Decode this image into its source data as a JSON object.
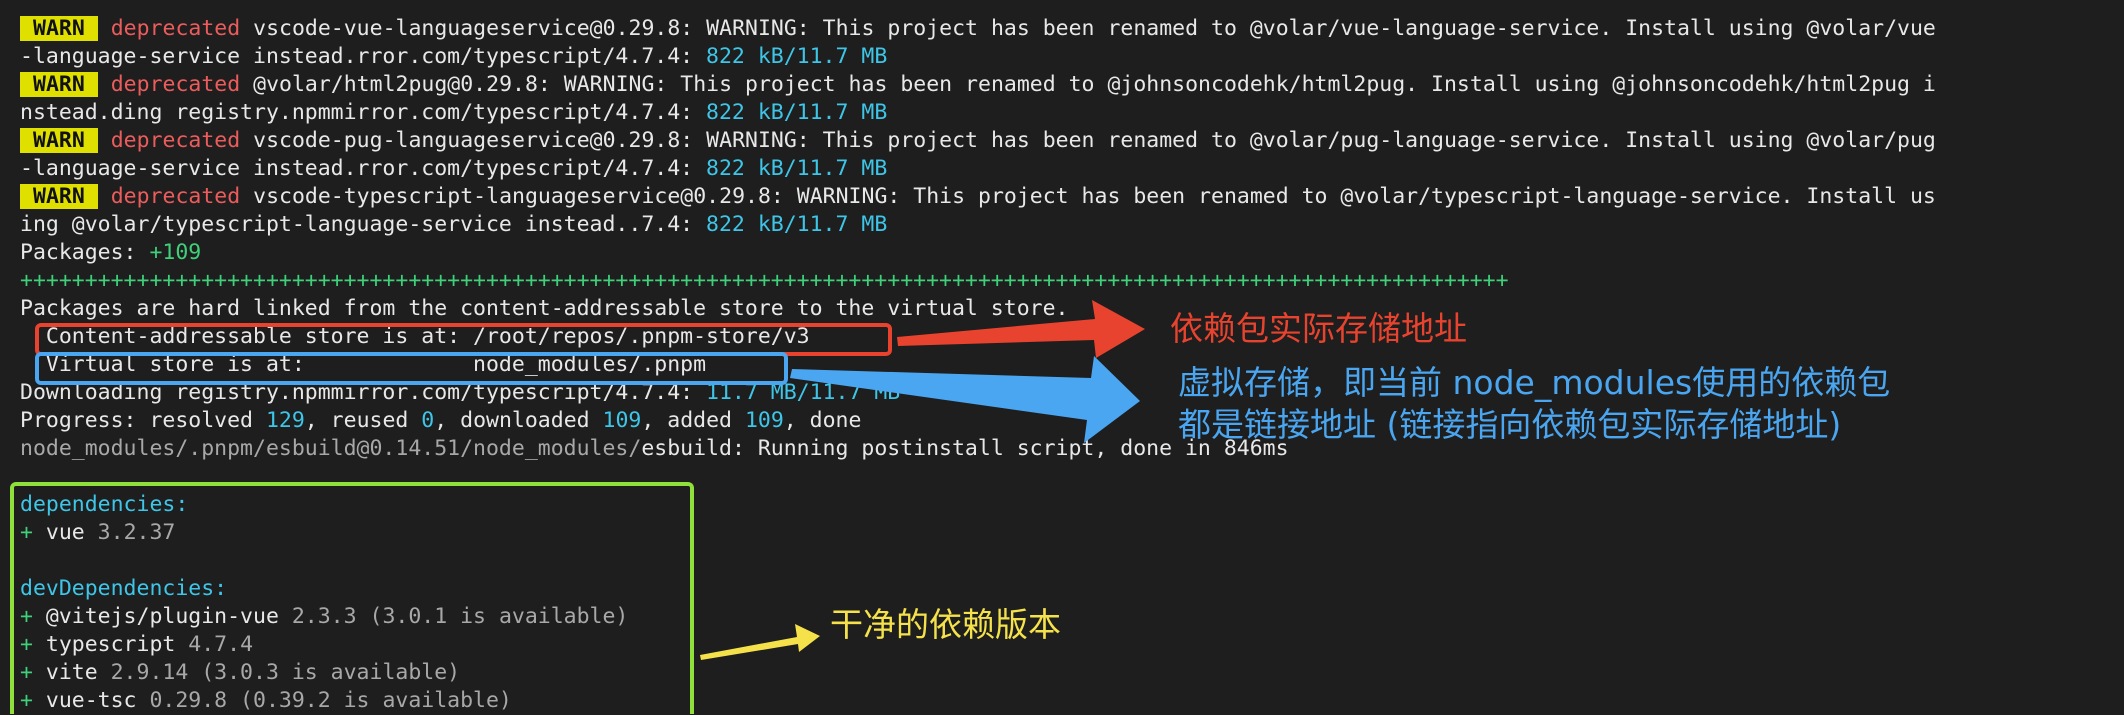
{
  "terminal": {
    "warn1": {
      "tag": "WARN",
      "level": "deprecated",
      "text": " vscode-vue-languageservice@0.29.8: WARNING: This project has been renamed to @volar/vue-language-service. Install using @volar/vue",
      "cont": "-language-service instead.rror.com/typescript/4.7.4: ",
      "progress_done": "822 kB",
      "sep": "/",
      "progress_total": "11.7 MB"
    },
    "warn2": {
      "tag": "WARN",
      "level": "deprecated",
      "text": " @volar/html2pug@0.29.8: WARNING: This project has been renamed to @johnsoncodehk/html2pug. Install using @johnsoncodehk/html2pug i",
      "cont": "nstead.ding registry.npmmirror.com/typescript/4.7.4: ",
      "progress_done": "822 kB",
      "sep": "/",
      "progress_total": "11.7 MB"
    },
    "warn3": {
      "tag": "WARN",
      "level": "deprecated",
      "text": " vscode-pug-languageservice@0.29.8: WARNING: This project has been renamed to @volar/pug-language-service. Install using @volar/pug",
      "cont": "-language-service instead.rror.com/typescript/4.7.4: ",
      "progress_done": "822 kB",
      "sep": "/",
      "progress_total": "11.7 MB"
    },
    "warn4": {
      "tag": "WARN",
      "level": "deprecated",
      "text": " vscode-typescript-languageservice@0.29.8: WARNING: This project has been renamed to @volar/typescript-language-service. Install us",
      "cont": "ing @volar/typescript-language-service instead..7.4: ",
      "progress_done": "822 kB",
      "sep": "/",
      "progress_total": "11.7 MB"
    },
    "packages": {
      "label": "Packages: ",
      "count": "+109"
    },
    "plus_bar": "+++++++++++++++++++++++++++++++++++++++++++++++++++++++++++++++++++++++++++++++++++++++++++++++++++++++++++++++++++",
    "hard_linked": "Packages are hard linked from the content-addressable store to the virtual store.",
    "store_line": "  Content-addressable store is at: /root/repos/.pnpm-store/v3",
    "virtual_line": "  Virtual store is at:             node_modules/.pnpm",
    "downloading": {
      "prefix": "Downloading registry.npmmirror.com/typescript/4.7.4: ",
      "done": "11.7 MB",
      "sep": "/",
      "total": "11.7 MB"
    },
    "progress": {
      "prefix": "Progress: resolved ",
      "resolved": "129",
      "reused_label": ", reused ",
      "reused": "0",
      "downloaded_label": ", downloaded ",
      "downloaded": "109",
      "added_label": ", added ",
      "added": "109",
      "done_label": ", done"
    },
    "esbuild": {
      "path": "node_modules/.pnpm/esbuild@0.14.51/node_modules/",
      "pkg": "esbuild",
      "msg": ": Running postinstall script, done in 846ms"
    },
    "dependencies_header": "dependencies:",
    "dependencies": [
      {
        "plus": "+ ",
        "name": "vue",
        "version": " 3.2.37"
      }
    ],
    "devdependencies_header": "devDependencies:",
    "devdependencies": [
      {
        "plus": "+ ",
        "name": "@vitejs/plugin-vue",
        "version": " 2.3.3 (3.0.1 is available)"
      },
      {
        "plus": "+ ",
        "name": "typescript",
        "version": " 4.7.4"
      },
      {
        "plus": "+ ",
        "name": "vite",
        "version": " 2.9.14 (3.0.3 is available)"
      },
      {
        "plus": "+ ",
        "name": "vue-tsc",
        "version": " 0.29.8 (0.39.2 is available)"
      }
    ]
  },
  "annotations": {
    "store_note": "依赖包实际存储地址",
    "virtual_note_line1": "虚拟存储，即当前 node_modules使用的依赖包",
    "virtual_note_line2": "都是链接地址 (链接指向依赖包实际存储地址)",
    "deps_note": "干净的依赖版本"
  },
  "colors": {
    "background": "#1e1e1e",
    "warn_badge": "#e0e000",
    "deprecated": "#ec5c5c",
    "cyan": "#3ec6e8",
    "green": "#3fd07a",
    "red_annotation": "#e8432e",
    "blue_annotation": "#4aa6f0",
    "green_box": "#8fe03a",
    "yellow_annotation": "#f5e24a"
  }
}
